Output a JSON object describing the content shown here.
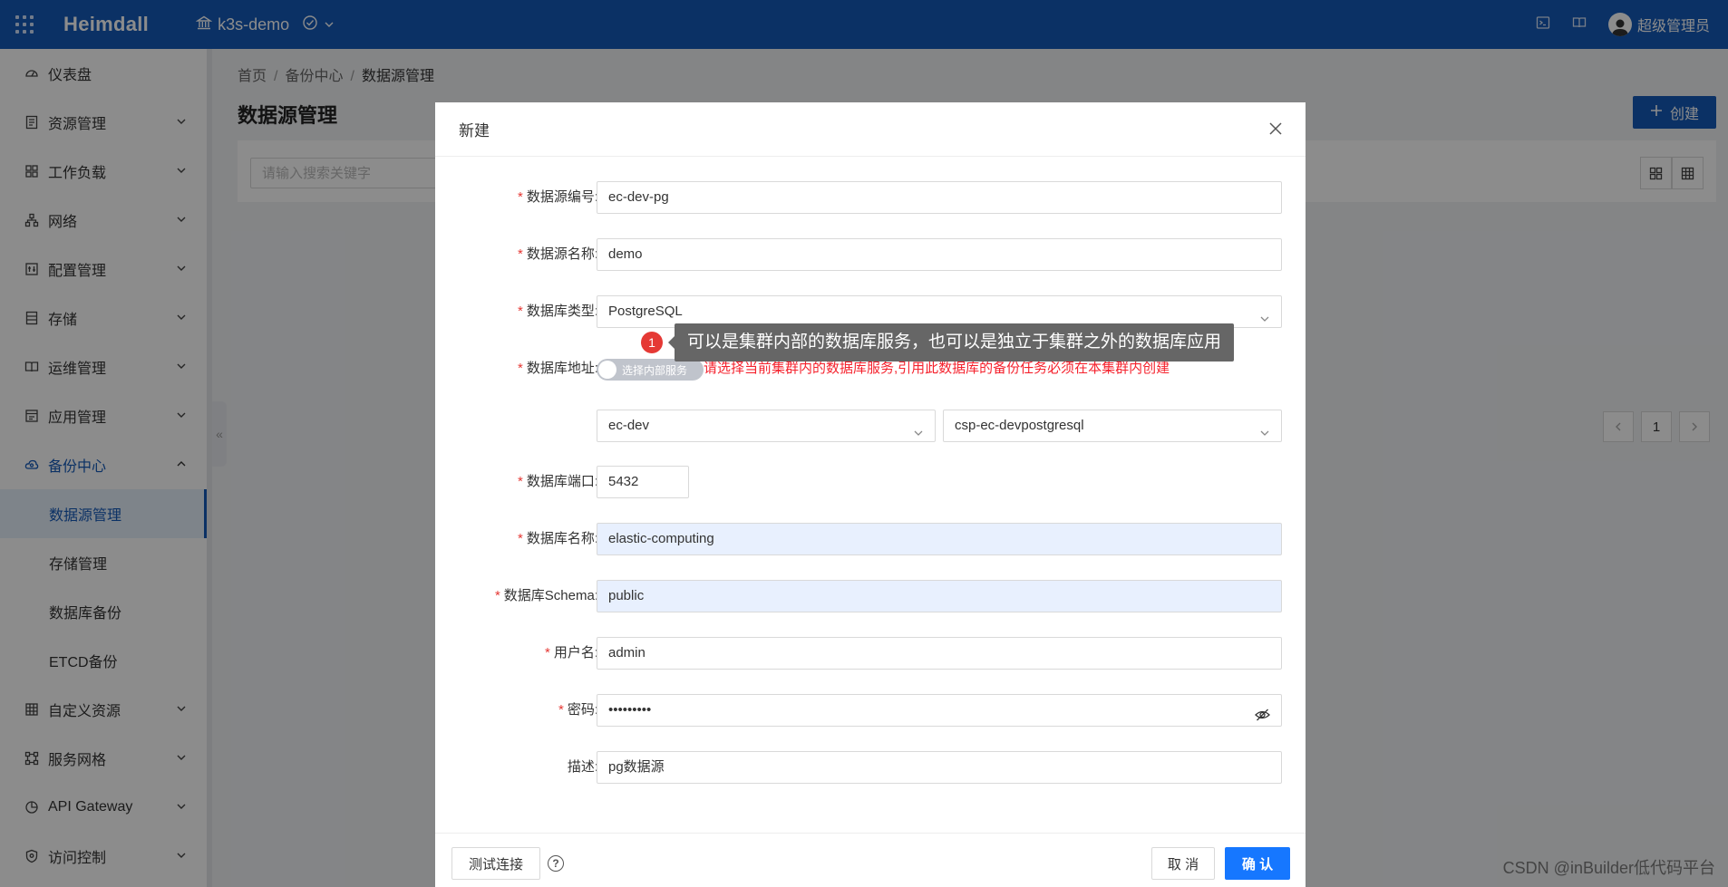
{
  "topbar": {
    "brand": "Heimdall",
    "cluster": "k3s-demo",
    "user": "超级管理员"
  },
  "sidebar": {
    "items": [
      {
        "label": "仪表盘",
        "icon": "dashboard-icon"
      },
      {
        "label": "资源管理",
        "icon": "resource-icon"
      },
      {
        "label": "工作负载",
        "icon": "workload-icon"
      },
      {
        "label": "网络",
        "icon": "network-icon"
      },
      {
        "label": "配置管理",
        "icon": "config-icon"
      },
      {
        "label": "存储",
        "icon": "storage-icon"
      },
      {
        "label": "运维管理",
        "icon": "ops-icon"
      },
      {
        "label": "应用管理",
        "icon": "app-icon"
      },
      {
        "label": "备份中心",
        "icon": "backup-icon"
      },
      {
        "label": "自定义资源",
        "icon": "custom-resource-icon"
      },
      {
        "label": "服务网格",
        "icon": "service-mesh-icon"
      },
      {
        "label": "API Gateway",
        "icon": "api-gateway-icon"
      },
      {
        "label": "访问控制",
        "icon": "access-control-icon"
      }
    ],
    "backup_subitems": [
      "数据源管理",
      "存储管理",
      "数据库备份",
      "ETCD备份"
    ]
  },
  "breadcrumb": [
    "首页",
    "备份中心",
    "数据源管理"
  ],
  "page": {
    "title": "数据源管理",
    "create_label": "创建",
    "search_placeholder": "请输入搜索关键字",
    "current_page": "1"
  },
  "modal": {
    "title": "新建",
    "fields": {
      "code": {
        "label": "数据源编号:",
        "value": "ec-dev-pg"
      },
      "name": {
        "label": "数据源名称:",
        "value": "demo"
      },
      "type": {
        "label": "数据库类型:",
        "value": "PostgreSQL"
      },
      "address": {
        "label": "数据库地址:",
        "toggle_text": "选择内部服务",
        "hint": "请选择当前集群内的数据库服务,引用此数据库的备份任务必须在本集群内创建"
      },
      "namespace": {
        "value": "ec-dev"
      },
      "service": {
        "value": "csp-ec-devpostgresql"
      },
      "port": {
        "label": "数据库端口:",
        "value": "5432"
      },
      "dbname": {
        "label": "数据库名称:",
        "value": "elastic-computing"
      },
      "schema": {
        "label": "数据库Schema:",
        "value": "public"
      },
      "username": {
        "label": "用户名:",
        "value": "admin"
      },
      "password": {
        "label": "密码:",
        "value": "•••••••••"
      },
      "description": {
        "label": "描述:",
        "value": "pg数据源"
      }
    },
    "tooltip": {
      "badge": "1",
      "text": "可以是集群内部的数据库服务，也可以是独立于集群之外的数据库应用"
    },
    "footer": {
      "test_label": "测试连接",
      "cancel_label": "取 消",
      "confirm_label": "确 认"
    }
  },
  "watermark": "CSDN @inBuilder低代码平台",
  "colors": {
    "primary": "#1459b8",
    "confirm": "#1677ff",
    "required": "#e53935",
    "hint": "#f5222d"
  }
}
